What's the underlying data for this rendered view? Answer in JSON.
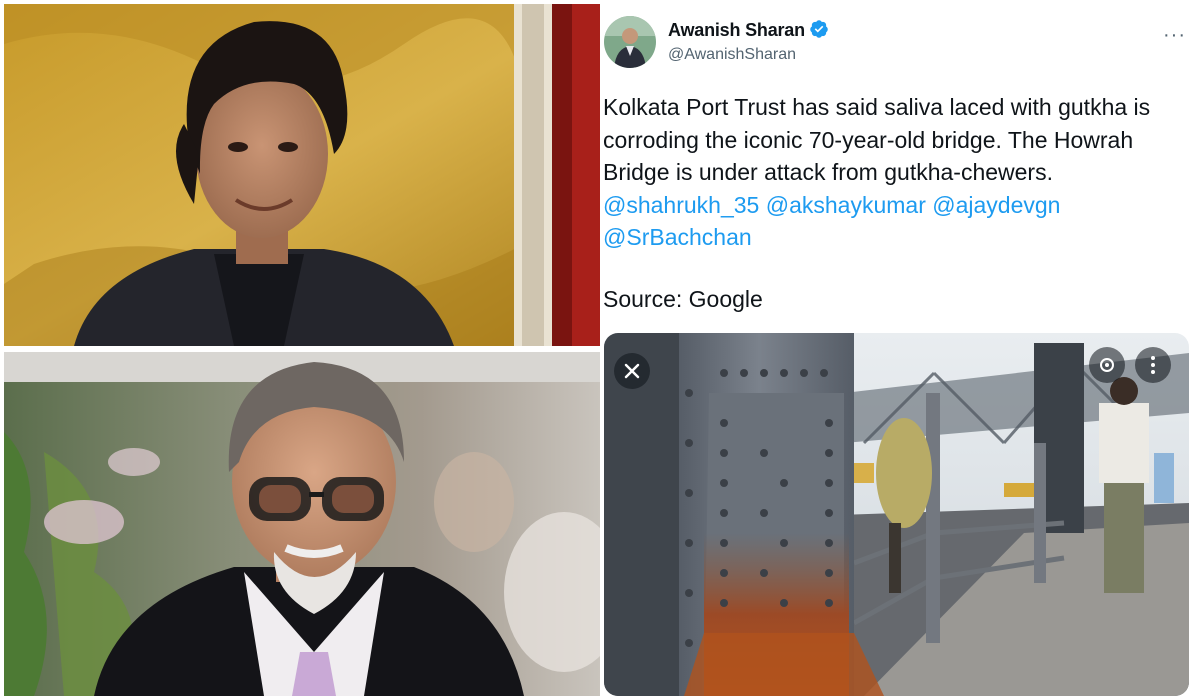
{
  "tweet": {
    "display_name": "Awanish Sharan",
    "handle": "@AwanishSharan",
    "text_parts": [
      "Kolkata Port Trust has said saliva laced with gutkha is corroding the iconic 70-year-old bridge. The Howrah Bridge is under attack from gutkha-chewers. "
    ],
    "mentions": [
      "@shahrukh_35",
      "@akshaykumar",
      "@ajaydevgn",
      "@SrBachchan"
    ],
    "source": "Source: Google",
    "more_icon": "···"
  },
  "colors": {
    "mention": "#1d9bf0",
    "verified": "#1d9bf0",
    "text": "#0f1419",
    "secondary": "#536471"
  },
  "icons": {
    "verified": "verified-badge-icon",
    "close": "close-icon",
    "more": "more-horizontal-icon"
  }
}
